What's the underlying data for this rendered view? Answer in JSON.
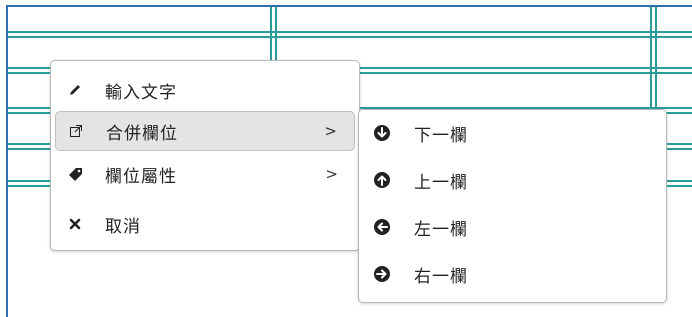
{
  "context_menu": {
    "items": [
      {
        "label": "輸入文字",
        "icon": "pencil-icon"
      },
      {
        "label": "合併欄位",
        "icon": "external-link-icon",
        "submenu_arrow": ">"
      },
      {
        "label": "欄位屬性",
        "icon": "tag-icon",
        "submenu_arrow": ">"
      },
      {
        "label": "取消",
        "icon": "close-icon"
      }
    ]
  },
  "submenu": {
    "items": [
      {
        "label": "下一欄",
        "icon": "arrow-circle-down-icon"
      },
      {
        "label": "上一欄",
        "icon": "arrow-circle-up-icon"
      },
      {
        "label": "左一欄",
        "icon": "arrow-circle-left-icon"
      },
      {
        "label": "右一欄",
        "icon": "arrow-circle-right-icon"
      }
    ]
  },
  "colors": {
    "grid_teal": "#2a9d9a",
    "grid_blue": "#2f6fb0",
    "active_item_bg": "#e4e4e4"
  }
}
